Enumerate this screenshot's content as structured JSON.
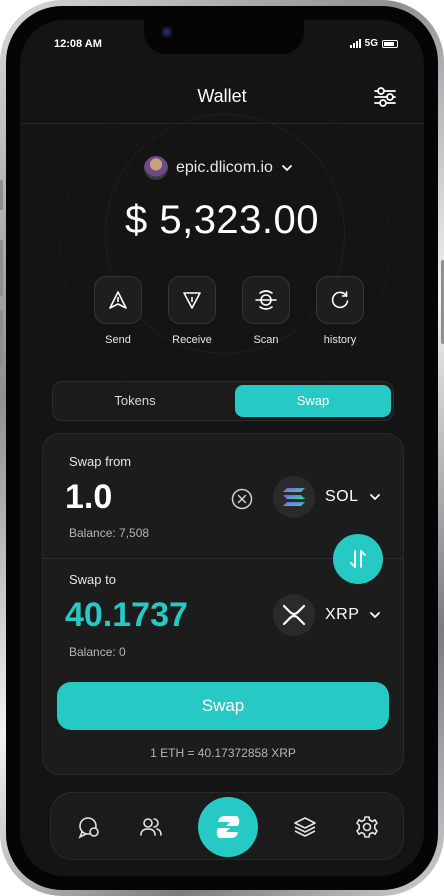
{
  "status": {
    "time": "12:08 AM",
    "network": "5G"
  },
  "header": {
    "title": "Wallet"
  },
  "account": {
    "name": "epic.dlicom.io"
  },
  "balance": "$ 5,323.00",
  "actions": [
    {
      "label": "Send",
      "icon": "send-icon"
    },
    {
      "label": "Receive",
      "icon": "receive-icon"
    },
    {
      "label": "Scan",
      "icon": "scan-icon"
    },
    {
      "label": "history",
      "icon": "history-icon"
    }
  ],
  "tabs": {
    "tokens": "Tokens",
    "swap": "Swap",
    "active": "Swap"
  },
  "swap_from": {
    "label": "Swap from",
    "amount": "1.0",
    "balance": "Balance: 7,508",
    "token": "SOL"
  },
  "swap_to": {
    "label": "Swap to",
    "amount": "40.1737",
    "balance": "Balance: 0",
    "token": "XRP"
  },
  "swap_button": "Swap",
  "rate": "1 ETH = 40.17372858 XRP",
  "nav": [
    "chat-icon",
    "users-icon",
    "swap-logo-icon",
    "layers-icon",
    "settings-icon"
  ],
  "colors": {
    "accent": "#27c9c4",
    "background": "#141414",
    "card": "#1c1c1c",
    "to_amount": "#27c9c4"
  }
}
